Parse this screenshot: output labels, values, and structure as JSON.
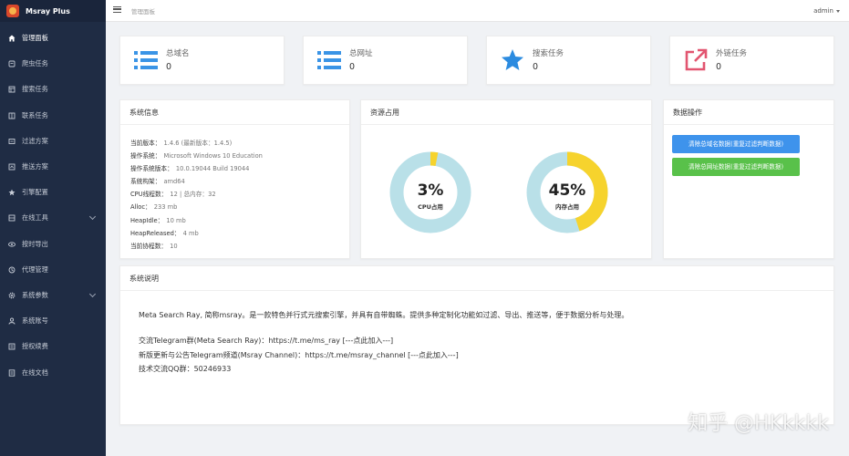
{
  "app": {
    "title": "Msray Plus"
  },
  "sidebar": {
    "items": [
      {
        "label": "管理面板",
        "icon": "home-icon",
        "active": true
      },
      {
        "label": "爬虫任务",
        "icon": "crawler-icon"
      },
      {
        "label": "搜索任务",
        "icon": "search-task-icon"
      },
      {
        "label": "联系任务",
        "icon": "contact-task-icon"
      },
      {
        "label": "过滤方案",
        "icon": "filter-icon"
      },
      {
        "label": "推送方案",
        "icon": "push-icon"
      },
      {
        "label": "引擎配置",
        "icon": "star-icon"
      },
      {
        "label": "在线工具",
        "icon": "tools-icon",
        "expandable": true
      },
      {
        "label": "按时导出",
        "icon": "eye-icon"
      },
      {
        "label": "代理管理",
        "icon": "proxy-icon"
      },
      {
        "label": "系统参数",
        "icon": "gear-icon",
        "expandable": true
      },
      {
        "label": "系统账号",
        "icon": "user-icon"
      },
      {
        "label": "授权续费",
        "icon": "license-icon"
      },
      {
        "label": "在线文档",
        "icon": "document-icon"
      }
    ]
  },
  "header": {
    "title": "管理面板",
    "user": "admin"
  },
  "stats": [
    {
      "title": "总域名",
      "value": "0",
      "icon": "list-icon"
    },
    {
      "title": "总网址",
      "value": "0",
      "icon": "list-icon"
    },
    {
      "title": "搜索任务",
      "value": "0",
      "icon": "star-icon"
    },
    {
      "title": "外链任务",
      "value": "0",
      "icon": "external-link-icon"
    }
  ],
  "system_info": {
    "title": "系统信息",
    "rows": [
      {
        "label": "当前版本：",
        "value": "1.4.6 (最新版本：1.4.5)"
      },
      {
        "label": "操作系统：",
        "value": "Microsoft Windows 10 Education"
      },
      {
        "label": "操作系统版本：",
        "value": "10.0.19044 Build 19044"
      },
      {
        "label": "系统构架：",
        "value": "amd64"
      },
      {
        "label": "CPU线程数：",
        "value": "12 | 总内存：32"
      },
      {
        "label": "Alloc：",
        "value": "233 mb"
      },
      {
        "label": "HeapIdle：",
        "value": "10 mb"
      },
      {
        "label": "HeapReleased：",
        "value": "4 mb"
      },
      {
        "label": "当前协程数：",
        "value": "10"
      }
    ]
  },
  "resources": {
    "title": "资源占用",
    "gauges": [
      {
        "percent_text": "3%",
        "fraction": 0.03,
        "label": "CPU占用"
      },
      {
        "percent_text": "45%",
        "fraction": 0.45,
        "label": "内存占用"
      }
    ],
    "colors": {
      "track": "#b9e0e8",
      "fill": "#f6d32d"
    }
  },
  "data_ops": {
    "title": "数据操作",
    "clear_domains": "清除总域名数据(重复过滤判断数据)",
    "clear_urls": "清除总网址数据(重复过滤判断数据)"
  },
  "description": {
    "title": "系统说明",
    "intro": "Meta Search Ray, 简称msray。是一款特色并行式元搜索引擎，并具有自带蜘蛛。提供多种定制化功能如过滤、导出、推送等，便于数据分析与处理。",
    "telegram_group": "交流Telegram群(Meta Search Ray)：https://t.me/ms_ray [---点此加入---]",
    "telegram_channel": "新版更新与公告Telegram频道(Msray Channel)：https://t.me/msray_channel [---点此加入---]",
    "qq_group": "技术交流QQ群：50246933"
  },
  "watermark": "知乎 @HKkkkk"
}
